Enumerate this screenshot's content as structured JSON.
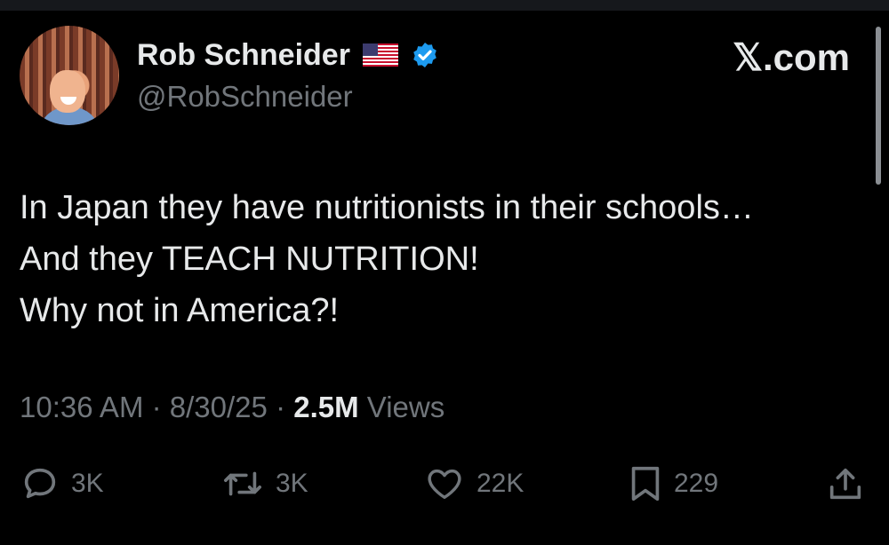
{
  "author": {
    "name": "Rob Schneider",
    "handle": "@RobSchneider",
    "flag_icon": "us-flag",
    "verified_icon": "verified-badge",
    "verified_color": "#1d9bf0"
  },
  "brand": {
    "label": "𝕏.com"
  },
  "tweet": {
    "lines": [
      "In Japan they have nutritionists in their schools…",
      "And they TEACH NUTRITION!",
      "Why not in America?!"
    ]
  },
  "meta": {
    "time": "10:36 AM",
    "separator": "·",
    "date": "8/30/25",
    "views_count": "2.5M",
    "views_label": "Views"
  },
  "actions": {
    "reply": {
      "icon": "reply-icon",
      "count": "3K"
    },
    "repost": {
      "icon": "repost-icon",
      "count": "3K"
    },
    "like": {
      "icon": "heart-icon",
      "count": "22K"
    },
    "bookmark": {
      "icon": "bookmark-icon",
      "count": "229"
    },
    "share": {
      "icon": "share-icon"
    }
  },
  "colors": {
    "background": "#000000",
    "text": "#e7e9ea",
    "muted": "#71767b"
  }
}
